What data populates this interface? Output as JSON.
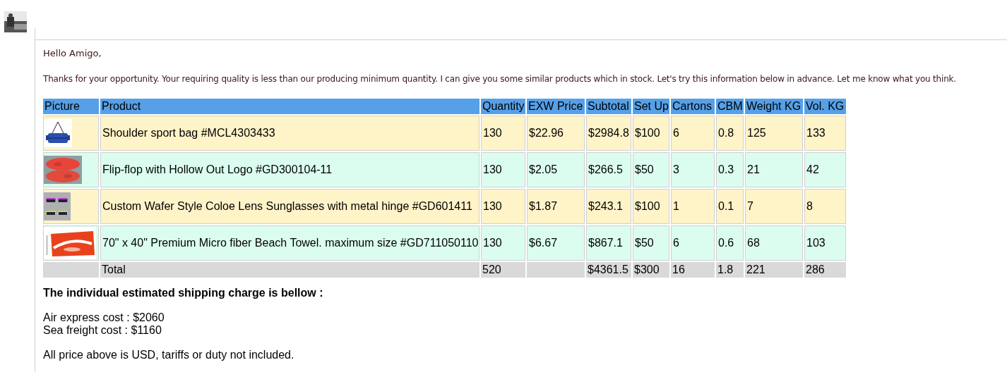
{
  "greeting": "Hello Amigo,",
  "message": "Thanks for your opportunity. Your requiring quality is less than our producing minimum quantity. I can give you some similar products which in stock. Let's try this information below in advance. Let me know what you think.",
  "table": {
    "columns": [
      "Picture",
      "Product",
      "Quantity",
      "EXW Price",
      "Subtotal",
      "Set Up",
      "Cartons",
      "CBM",
      "Weight KG",
      "Vol. KG"
    ],
    "rows": [
      {
        "cells": [
          {
            "kind": "picture"
          },
          "Shoulder sport bag #MCL4303433",
          "130",
          "$22.96",
          "$2984.8",
          "$100",
          "6",
          "0.8",
          "125",
          "133"
        ]
      },
      {
        "cells": [
          {
            "kind": "picture"
          },
          "Flip-flop with Hollow Out Logo #GD300104-11",
          "130",
          "$2.05",
          "$266.5",
          "$50",
          "3",
          "0.3",
          "21",
          "42"
        ]
      },
      {
        "cells": [
          {
            "kind": "picture"
          },
          "Custom Wafer Style Coloe Lens Sunglasses with metal hinge #GD601411",
          "130",
          "$1.87",
          "$243.1",
          "$100",
          "1",
          "0.1",
          "7",
          "8"
        ]
      },
      {
        "cells": [
          {
            "kind": "picture"
          },
          "70\" x 40\" Premium Micro fiber Beach Towel. maximum size #GD711050110",
          "130",
          "$6.67",
          "$867.1",
          "$50",
          "6",
          "0.6",
          "68",
          "103"
        ]
      }
    ],
    "total": {
      "cells": [
        null,
        "Total",
        "520",
        null,
        "$4361.5",
        "$300",
        "16",
        "1.8",
        "221",
        "286"
      ]
    }
  },
  "shipping_heading": "The individual estimated shipping charge is bellow :",
  "shipping_lines": [
    "Air express cost : $2060",
    "Sea freight cost : $1160"
  ],
  "note": "All price above is USD, tariffs or duty not included."
}
